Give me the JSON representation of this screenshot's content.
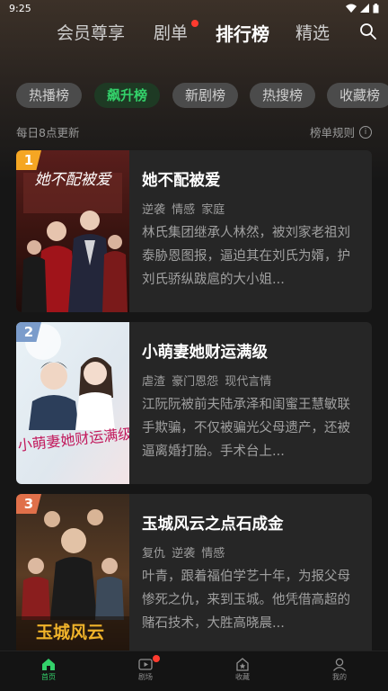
{
  "status_bar": {
    "time": "9:25"
  },
  "top_tabs": [
    {
      "label": "会员尊享"
    },
    {
      "label": "剧单"
    },
    {
      "label": "排行榜"
    },
    {
      "label": "精选"
    }
  ],
  "active_top_tab": "排行榜",
  "chips": [
    {
      "label": "热播榜"
    },
    {
      "label": "飙升榜"
    },
    {
      "label": "新剧榜"
    },
    {
      "label": "热搜榜"
    },
    {
      "label": "收藏榜"
    }
  ],
  "active_chip": "飙升榜",
  "subheader": {
    "update_note": "每日8点更新",
    "rules_link": "榜单规则"
  },
  "rankings": [
    {
      "rank": "1",
      "title": "她不配被爱",
      "tags": "逆袭 情感 家庭",
      "description": "林氏集团继承人林然，被刘家老祖刘泰胁恩图报，逼迫其在刘氏为婿，护刘氏骄纵跋扈的大小姐..."
    },
    {
      "rank": "2",
      "title": "小萌妻她财运满级",
      "tags": "虐渣 豪门恩怨 现代言情",
      "description": "江阮阮被前夫陆承泽和闺蜜王慧敏联手欺骗，不仅被骗光父母遗产，还被逼离婚打胎。手术台上..."
    },
    {
      "rank": "3",
      "title": "玉城风云之点石成金",
      "tags": "复仇 逆袭 情感",
      "description": "叶青，跟着福伯学艺十年，为报父母惨死之仇，来到玉城。他凭借高超的赌石技术，大胜高晓晨..."
    }
  ],
  "poster_texts": [
    "她不配被爱",
    "小萌妻她财运满级",
    "玉城风云"
  ],
  "bottom_nav": [
    {
      "label": "首页",
      "icon": "home-icon"
    },
    {
      "label": "剧场",
      "icon": "theater-icon"
    },
    {
      "label": "收藏",
      "icon": "bookmark-icon"
    },
    {
      "label": "我的",
      "icon": "profile-icon"
    }
  ],
  "colors": {
    "accent_green": "#33d16a",
    "badge_dot": "#ff3b2f",
    "rank1": "#f5a623",
    "rank2": "#7b9ccb",
    "rank3": "#e0704a"
  }
}
